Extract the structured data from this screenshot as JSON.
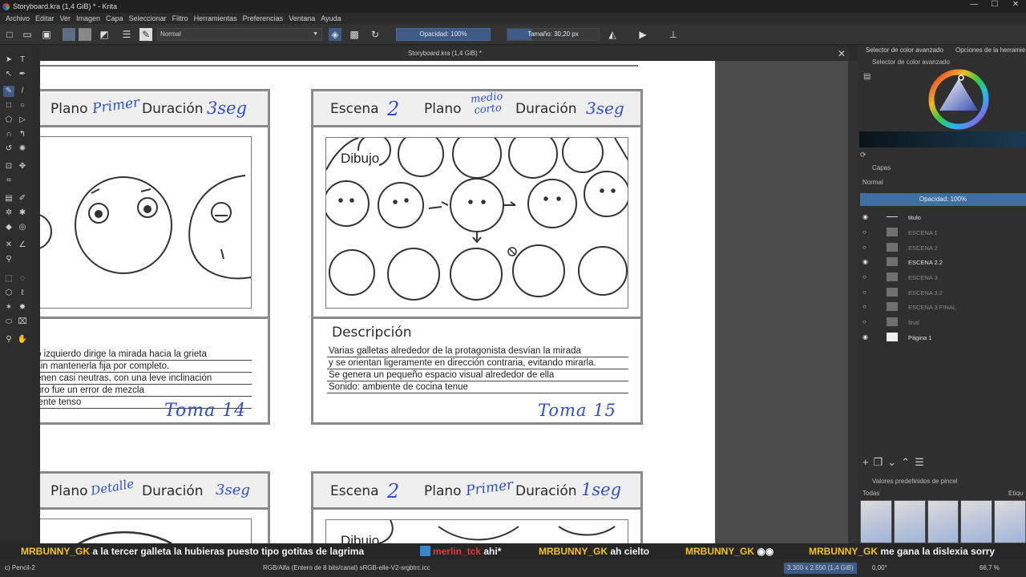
{
  "window": {
    "title": "Storyboard.kra (1,4 GiB) * - Krita",
    "controls": [
      "—",
      "☐",
      "✕"
    ]
  },
  "menu": [
    "Archivo",
    "Editar",
    "Ver",
    "Imagen",
    "Capa",
    "Seleccionar",
    "Filtro",
    "Herramientas",
    "Preferencias",
    "Ventana",
    "Ayuda"
  ],
  "toolbar": {
    "blend_mode": "Normal",
    "opacity": "Opacidad: 100%",
    "opacity_fraction": 1.0,
    "size": "Tamaño: 30,20 px"
  },
  "document_tab": {
    "title": "Storyboard.kra (1,4 GiB) *",
    "close": "✕"
  },
  "storyboard": {
    "card_a": {
      "plano": "Plano",
      "plano_hw": "Primer",
      "duracion": "Duración",
      "duracion_hw": "3seg",
      "desc": [
        "o izquierdo dirige la mirada hacia la grieta",
        "sin mantenerla fija por completo.",
        "enen casi neutras, con una leve inclinación",
        "uro fue un error de mezcla",
        "iente tenso"
      ],
      "toma_hw": "Toma 14"
    },
    "card_b": {
      "escena": "Escena",
      "escena_hw": "2",
      "plano": "Plano",
      "plano_hw": "medio corto",
      "duracion": "Duración",
      "duracion_hw": "3seg",
      "dibujo": "Dibujo",
      "descripcion": "Descripción",
      "desc": [
        "Varias galletas alrededor de la protagonista desvían la mirada",
        "y se orientan ligeramente en dirección contraria, evitando mirarla.",
        "Se genera un pequeño espacio visual alrededor de ella",
        "Sonido: ambiente de cocina tenue"
      ],
      "toma_hw": "Toma 15"
    },
    "card_c": {
      "plano": "Plano",
      "plano_hw": "Detalle",
      "duracion": "Duración",
      "duracion_hw": "3seg"
    },
    "card_d": {
      "escena": "Escena",
      "escena_hw": "2",
      "plano": "Plano",
      "plano_hw": "Primer",
      "duracion": "Duración",
      "duracion_hw": "1seg",
      "dibujo": "Dibujo"
    }
  },
  "dock": {
    "tabs": [
      "Selector de color avanzado",
      "Opciones de la herramie"
    ],
    "color_panel_title": "Selector de color avanzado",
    "layers_title": "Capas",
    "layers_blend": "Normal",
    "layers_opacity": "Opacidad:  100%",
    "layers": [
      {
        "name": "titulo",
        "visible": true,
        "thumb": "line"
      },
      {
        "name": "ESCENA 1",
        "visible": false,
        "thumb": "gray"
      },
      {
        "name": "ESCENA 2",
        "visible": false,
        "thumb": "gray"
      },
      {
        "name": "ESCENA 2.2",
        "visible": true,
        "thumb": "gray"
      },
      {
        "name": "ESCENA 3",
        "visible": false,
        "thumb": "gray"
      },
      {
        "name": "ESCENA 3.2",
        "visible": false,
        "thumb": "gray"
      },
      {
        "name": "ESCENA 3 FINAL",
        "visible": false,
        "thumb": "gray"
      },
      {
        "name": "final",
        "visible": false,
        "thumb": "gray"
      },
      {
        "name": "Página 1",
        "visible": true,
        "thumb": "white"
      }
    ],
    "presets_title": "Valores predefinidos de pincel",
    "presets_filter": "Todas",
    "presets_tag": "Etiqu"
  },
  "chat": [
    {
      "user": "MRBUNNY_GK",
      "msg": " a la tercer galleta la hubieras puesto tipo gotitas de lagrima"
    },
    {
      "user": "merlin_tck",
      "msg": " ahi*"
    },
    {
      "user": "MRBUNNY_GK",
      "msg": " ah cielto"
    },
    {
      "user": "MRBUNNY_GK",
      "msg": " ◉◉"
    },
    {
      "user": "MRBUNNY_GK",
      "msg": " me gana la dislexia sorry"
    }
  ],
  "status": {
    "brush": "c) Pencil-2",
    "color_info": "RGB/Alfa (Entero de 8 bits/canal)  sRGB-elle-V2-srgbtrc.icc",
    "dimensions": "3.300 x 2.550 (1,4 GiB)",
    "rotation": "0,00°",
    "zoom": "66,7 %"
  }
}
